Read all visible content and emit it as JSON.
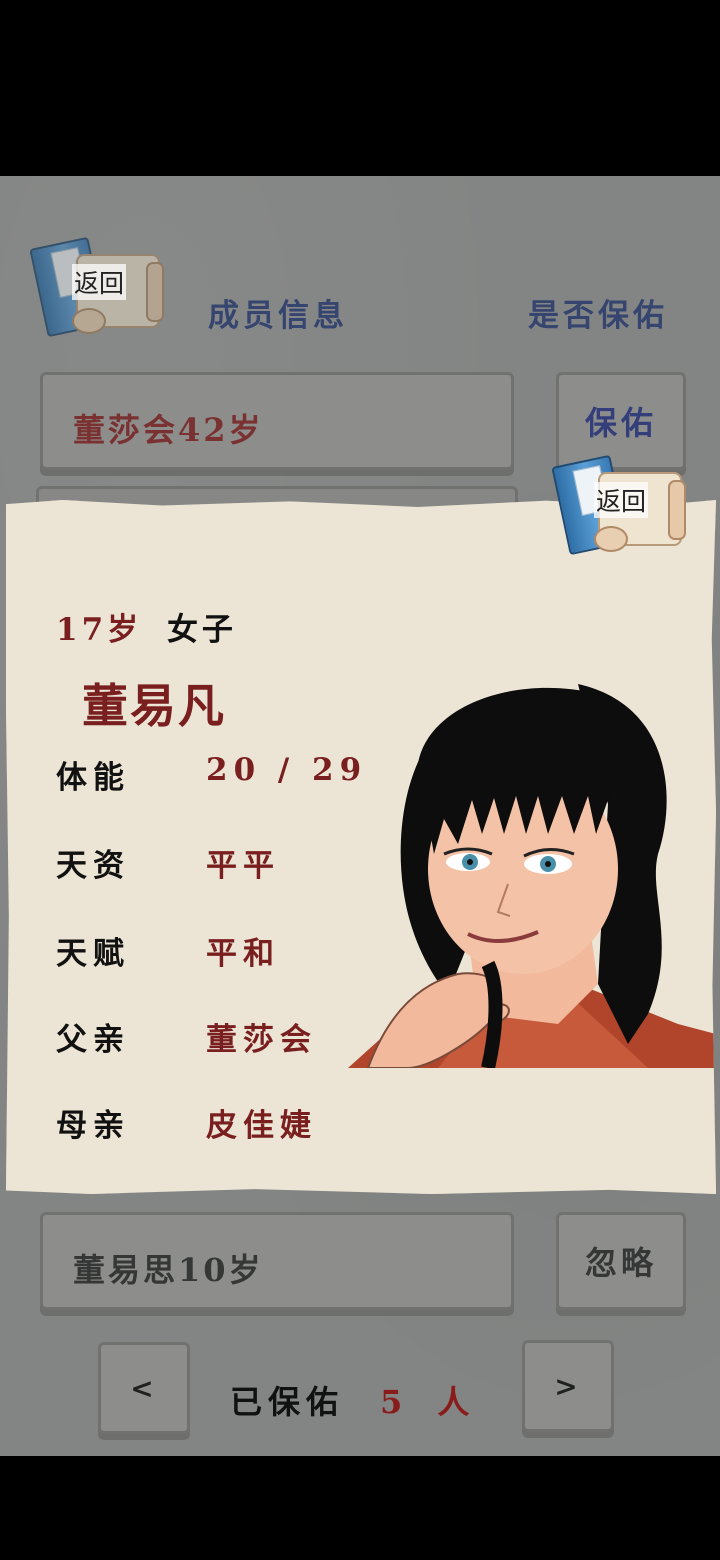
{
  "header": {
    "back_label": "返回",
    "col_member": "成员信息",
    "col_protect": "是否保佑"
  },
  "rows": [
    {
      "text": "董莎会42岁",
      "button": "保佑",
      "text_color": "#8a1b1b",
      "button_color": "#1f2f8a"
    },
    {
      "text": "董易思10岁",
      "button": "忽略",
      "text_color": "#222222",
      "button_color": "#222222"
    }
  ],
  "popup": {
    "back_label": "返回",
    "age": "17岁",
    "sex": "女子",
    "name": "董易凡",
    "stats": [
      {
        "label": "体能",
        "value": "20 / 29"
      },
      {
        "label": "天资",
        "value": "平平"
      },
      {
        "label": "天赋",
        "value": "平和"
      },
      {
        "label": "父亲",
        "value": "董莎会"
      },
      {
        "label": "母亲",
        "value": "皮佳婕"
      }
    ]
  },
  "footer": {
    "prev": "<",
    "next": ">",
    "label": "已保佑",
    "count": "5",
    "unit": "人"
  },
  "colors": {
    "accent_red": "#7a1f1f",
    "accent_blue": "#24397a",
    "paper": "#ece5d5",
    "background": "#9a9c9a"
  }
}
